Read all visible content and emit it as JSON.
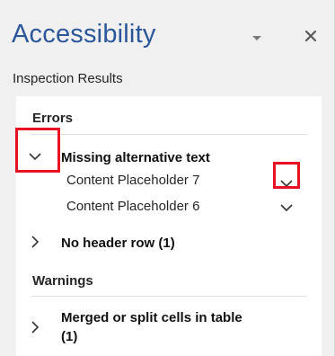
{
  "pane": {
    "title": "Accessibility",
    "subtitle": "Inspection Results"
  },
  "errors": {
    "heading": "Errors",
    "groups": [
      {
        "label": "Missing alternative text",
        "expanded": true,
        "items": [
          {
            "label": "Content Placeholder 7"
          },
          {
            "label": "Content Placeholder 6"
          }
        ]
      },
      {
        "label": "No header row (1)",
        "expanded": false
      }
    ]
  },
  "warnings": {
    "heading": "Warnings",
    "groups": [
      {
        "label_line1": "Merged or split cells in table",
        "label_line2": "(1)",
        "expanded": false
      }
    ]
  },
  "colors": {
    "title": "#2b579a",
    "highlight": "#e81123",
    "pane_background": "#f0f0f0",
    "results_background": "#ffffff"
  },
  "icons": {
    "pane_options": "caret-down-icon",
    "close": "close-icon",
    "expanded": "chevron-down-icon",
    "collapsed": "chevron-right-icon",
    "item_options": "chevron-down-icon"
  }
}
